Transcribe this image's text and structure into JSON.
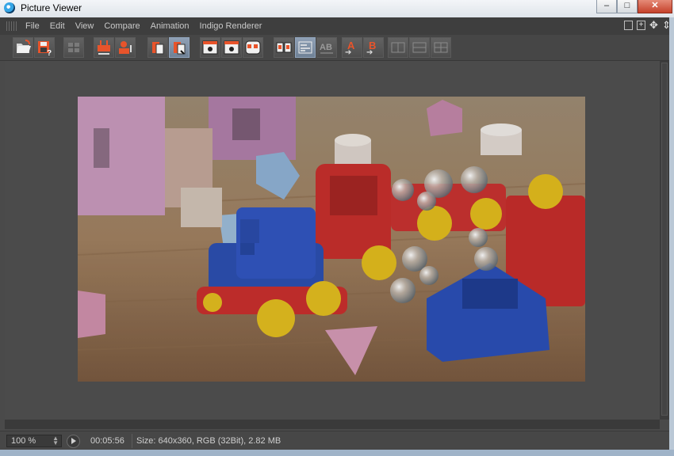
{
  "window": {
    "title": "Picture Viewer",
    "minimize": "–",
    "maximize": "□",
    "close": "✕"
  },
  "menu": [
    "File",
    "Edit",
    "View",
    "Compare",
    "Animation",
    "Indigo Renderer"
  ],
  "toolbar": {
    "compare_a_label": "A",
    "compare_b_label": "B",
    "icons": [
      "open-icon",
      "save-icon",
      "filter-icon",
      "render-region-icon",
      "render-to-pv-icon",
      "layers-icon",
      "layers-active-icon",
      "stereo-left-icon",
      "stereo-right-icon",
      "stereo-both-icon",
      "dual-view-icon",
      "dual-view-active-icon",
      "ab-compare-icon",
      "set-as-a-icon",
      "set-as-b-icon",
      "ab-split-icon",
      "ab-vertical-icon",
      "ab-horizontal-icon"
    ]
  },
  "status": {
    "zoom": "100 %",
    "time": "00:05:56",
    "info": "Size: 640x360, RGB (32Bit), 2.82 MB"
  },
  "colors": {
    "accent_orange": "#e8542b",
    "toy_red": "#cc2f2b",
    "toy_blue": "#2b4fb5",
    "toy_yellow": "#e8c21e"
  }
}
